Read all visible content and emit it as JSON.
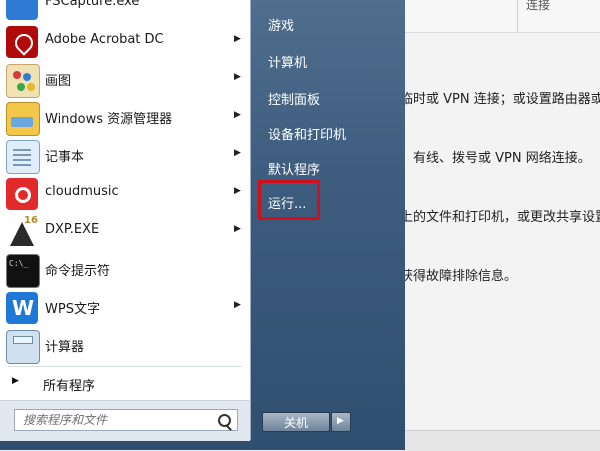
{
  "background_window": {
    "tab_fragment": "连接",
    "lines": [
      "临时或 VPN 连接；或设置路由器或访",
      "、有线、拨号或 VPN 网络连接。",
      "上的文件和打印机，或更改共享设置。",
      "获得故障排除信息。"
    ]
  },
  "pinned_programs": [
    {
      "label": "FSCapture.exe",
      "icon": "fscapture-icon",
      "submenu": false
    },
    {
      "label": "Adobe Acrobat DC",
      "icon": "acrobat-icon",
      "submenu": true
    },
    {
      "label": "画图",
      "icon": "paint-icon",
      "submenu": true
    },
    {
      "label": "Windows 资源管理器",
      "icon": "explorer-icon",
      "submenu": true
    },
    {
      "label": "记事本",
      "icon": "notepad-icon",
      "submenu": true
    },
    {
      "label": "cloudmusic",
      "icon": "cloudmusic-icon",
      "submenu": true
    },
    {
      "label": "DXP.EXE",
      "icon": "dxp-icon",
      "submenu": true
    },
    {
      "label": "命令提示符",
      "icon": "cmd-icon",
      "submenu": false
    },
    {
      "label": "WPS文字",
      "icon": "wps-icon",
      "submenu": true
    },
    {
      "label": "计算器",
      "icon": "calculator-icon",
      "submenu": false
    }
  ],
  "all_programs_label": "所有程序",
  "search": {
    "placeholder": "搜索程序和文件"
  },
  "right_pane": {
    "items": [
      "游戏",
      "计算机",
      "控制面板",
      "设备和打印机",
      "默认程序"
    ],
    "run_label": "运行..."
  },
  "shutdown_label": "关机",
  "colors": {
    "highlight_box": "#d20f1b"
  }
}
